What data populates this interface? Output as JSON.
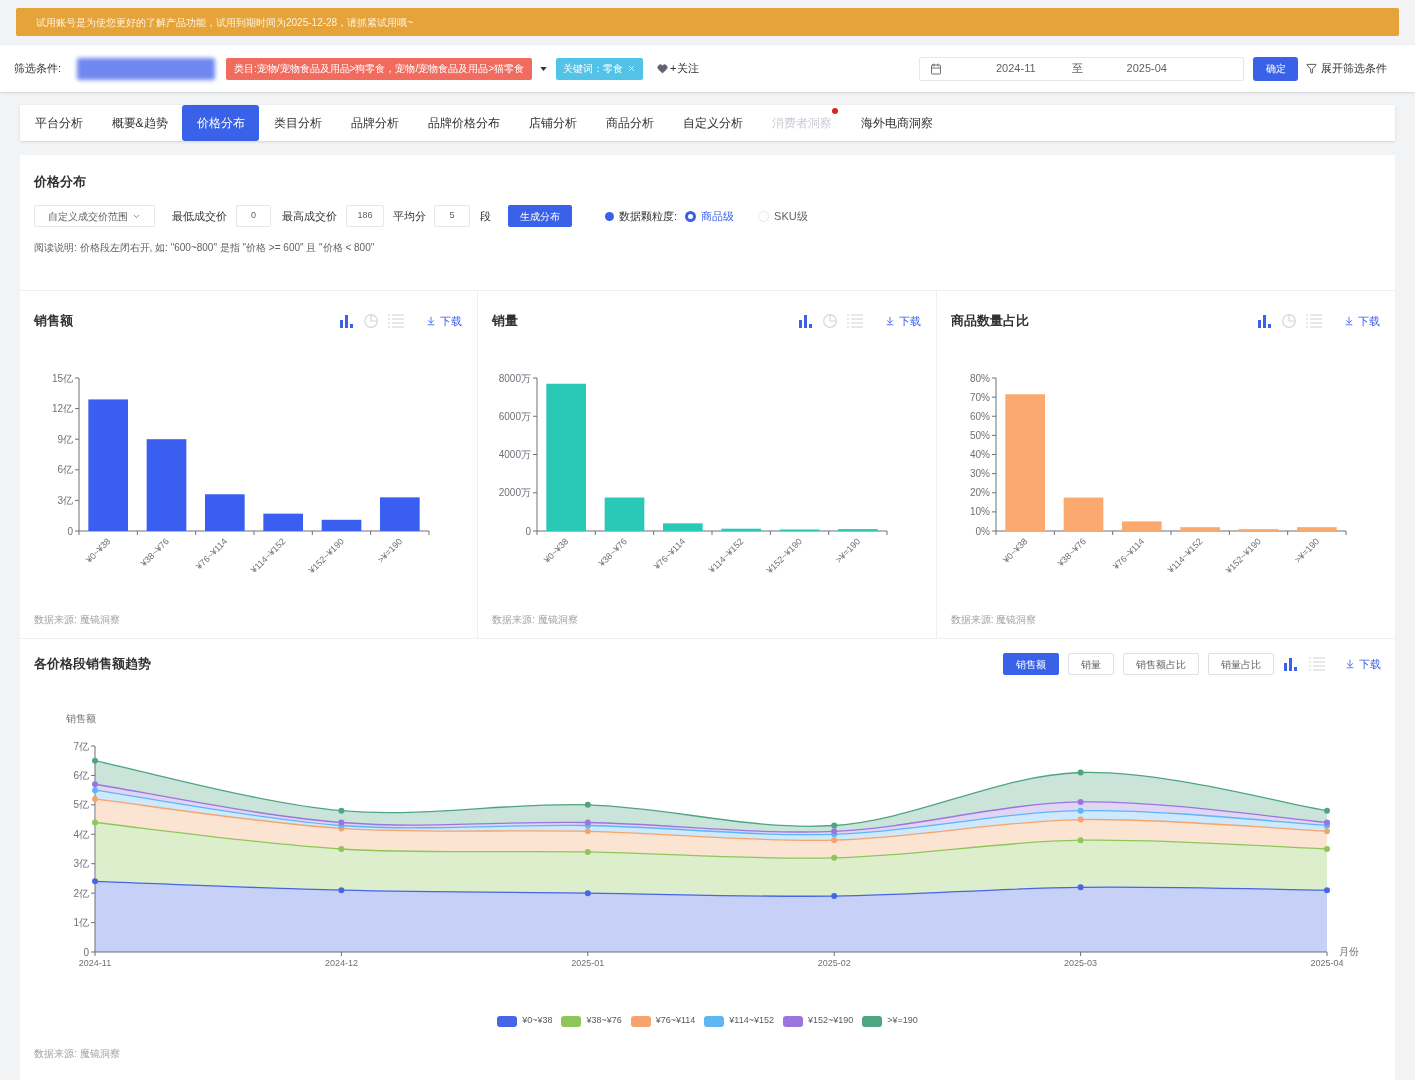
{
  "banner": {
    "text": "试用账号是为使您更好的了解产品功能，试用到期时间为2025-12-28，请抓紧试用哦~"
  },
  "filter_bar": {
    "label": "筛选条件:",
    "category_tag": "类目:宠物/宠物食品及用品>狗零食，宠物/宠物食品及用品>猫零食",
    "keyword_tag": "关键词：零食",
    "follow": "+关注",
    "date_from": "2024-11",
    "date_separator": "至",
    "date_to": "2025-04",
    "confirm_button": "确定",
    "expand_link": "展开筛选条件"
  },
  "tabs": [
    {
      "label": "平台分析",
      "selected": false,
      "disabled": false,
      "dot": false
    },
    {
      "label": "概要&趋势",
      "selected": false,
      "disabled": false,
      "dot": false
    },
    {
      "label": "价格分布",
      "selected": true,
      "disabled": false,
      "dot": false
    },
    {
      "label": "类目分析",
      "selected": false,
      "disabled": false,
      "dot": false
    },
    {
      "label": "品牌分析",
      "selected": false,
      "disabled": false,
      "dot": false
    },
    {
      "label": "品牌价格分布",
      "selected": false,
      "disabled": false,
      "dot": false
    },
    {
      "label": "店铺分析",
      "selected": false,
      "disabled": false,
      "dot": false
    },
    {
      "label": "商品分析",
      "selected": false,
      "disabled": false,
      "dot": false
    },
    {
      "label": "自定义分析",
      "selected": false,
      "disabled": false,
      "dot": false
    },
    {
      "label": "消费者洞察",
      "selected": false,
      "disabled": true,
      "dot": true
    },
    {
      "label": "海外电商洞察",
      "selected": false,
      "disabled": false,
      "dot": false
    }
  ],
  "price_distribution": {
    "title": "价格分布",
    "range_select": "自定义成交价范围",
    "min_label": "最低成交价",
    "min_value": "0",
    "max_label": "最高成交价",
    "max_value": "186",
    "split_label": "平均分",
    "split_value": "5",
    "split_unit": "段",
    "generate_button": "生成分布",
    "granularity_label": "数据颗粒度:",
    "granularity_options": [
      {
        "label": "商品级",
        "selected": true
      },
      {
        "label": "SKU级",
        "selected": false
      }
    ],
    "note": "阅读说明: 价格段左闭右开, 如: \"600~800\" 是指 \"价格 >= 600\" 且 \"价格 < 800\""
  },
  "charts": [
    {
      "title": "销售额",
      "view_toggles": [
        {
          "kind": "bar",
          "selected": true
        },
        {
          "kind": "pie",
          "selected": false
        },
        {
          "kind": "table",
          "selected": false
        }
      ],
      "download": "下载",
      "chart_data": {
        "type": "bar",
        "categories": [
          "¥0~¥38",
          "¥38~¥76",
          "¥76~¥114",
          "¥114~¥152",
          "¥152~¥190",
          ">¥=190"
        ],
        "values": [
          12.9,
          9,
          3.6,
          1.7,
          1.1,
          3.3
        ],
        "color": "#3a5ff0",
        "ylim": [
          0,
          15
        ],
        "yticks": [
          {
            "value": 0,
            "label": "0"
          },
          {
            "value": 3,
            "label": "3亿"
          },
          {
            "value": 6,
            "label": "6亿"
          },
          {
            "value": 9,
            "label": "9亿"
          },
          {
            "value": 12,
            "label": "12亿"
          },
          {
            "value": 15,
            "label": "15亿"
          }
        ]
      },
      "source": "数据来源: 魔镜洞察"
    },
    {
      "title": "销量",
      "view_toggles": [
        {
          "kind": "bar",
          "selected": true
        },
        {
          "kind": "pie",
          "selected": false
        },
        {
          "kind": "table",
          "selected": false
        }
      ],
      "download": "下载",
      "chart_data": {
        "type": "bar",
        "categories": [
          "¥0~¥38",
          "¥38~¥76",
          "¥76~¥114",
          "¥114~¥152",
          "¥152~¥190",
          ">¥=190"
        ],
        "values": [
          7700,
          1750,
          400,
          120,
          80,
          100
        ],
        "color": "#2ac8b6",
        "ylim": [
          0,
          8000
        ],
        "yticks": [
          {
            "value": 0,
            "label": "0"
          },
          {
            "value": 2000,
            "label": "2000万"
          },
          {
            "value": 4000,
            "label": "4000万"
          },
          {
            "value": 6000,
            "label": "6000万"
          },
          {
            "value": 8000,
            "label": "8000万"
          }
        ]
      },
      "source": "数据来源: 魔镜洞察"
    },
    {
      "title": "商品数量占比",
      "view_toggles": [
        {
          "kind": "bar",
          "selected": true
        },
        {
          "kind": "pie",
          "selected": false
        },
        {
          "kind": "table",
          "selected": false
        }
      ],
      "download": "下载",
      "chart_data": {
        "type": "bar",
        "categories": [
          "¥0~¥38",
          "¥38~¥76",
          "¥76~¥114",
          "¥114~¥152",
          "¥152~¥190",
          ">¥=190"
        ],
        "values": [
          71.5,
          17.5,
          5,
          2,
          1,
          2
        ],
        "color": "#fba96f",
        "ylim": [
          0,
          80
        ],
        "yticks": [
          {
            "value": 0,
            "label": "0%"
          },
          {
            "value": 10,
            "label": "10%"
          },
          {
            "value": 20,
            "label": "20%"
          },
          {
            "value": 30,
            "label": "30%"
          },
          {
            "value": 40,
            "label": "40%"
          },
          {
            "value": 50,
            "label": "50%"
          },
          {
            "value": 60,
            "label": "60%"
          },
          {
            "value": 70,
            "label": "70%"
          },
          {
            "value": 80,
            "label": "80%"
          }
        ]
      },
      "source": "数据来源: 魔镜洞察"
    }
  ],
  "trend": {
    "title": "各价格段销售额趋势",
    "metric_buttons": [
      {
        "label": "销售额",
        "selected": true
      },
      {
        "label": "销量",
        "selected": false
      },
      {
        "label": "销售额占比",
        "selected": false
      },
      {
        "label": "销量占比",
        "selected": false
      }
    ],
    "view_toggles": [
      {
        "kind": "bar",
        "selected": true
      },
      {
        "kind": "table",
        "selected": false
      }
    ],
    "download": "下载",
    "chart_data": {
      "type": "area",
      "stacked": true,
      "ylabel": "销售额",
      "xlabel": "月份",
      "categories": [
        "2024-11",
        "2024-12",
        "2025-01",
        "2025-02",
        "2025-03",
        "2025-04"
      ],
      "ylim": [
        0,
        7
      ],
      "yticks": [
        {
          "value": 0,
          "label": "0"
        },
        {
          "value": 1,
          "label": "1亿"
        },
        {
          "value": 2,
          "label": "2亿"
        },
        {
          "value": 3,
          "label": "3亿"
        },
        {
          "value": 4,
          "label": "4亿"
        },
        {
          "value": 5,
          "label": "5亿"
        },
        {
          "value": 6,
          "label": "6亿"
        },
        {
          "value": 7,
          "label": "7亿"
        }
      ],
      "legend": "bottom",
      "marker": "circle",
      "series": [
        {
          "name": "¥0~¥38",
          "color": "#4766e6",
          "values": [
            2.4,
            2.1,
            2.0,
            1.9,
            2.2,
            2.1
          ]
        },
        {
          "name": "¥38~¥76",
          "color": "#8fc65a",
          "values": [
            2.0,
            1.4,
            1.4,
            1.3,
            1.6,
            1.4
          ]
        },
        {
          "name": "¥76~¥114",
          "color": "#f6a46c",
          "values": [
            0.8,
            0.7,
            0.7,
            0.6,
            0.7,
            0.6
          ]
        },
        {
          "name": "¥114~¥152",
          "color": "#5eb6f2",
          "values": [
            0.3,
            0.1,
            0.2,
            0.2,
            0.3,
            0.2
          ]
        },
        {
          "name": "¥152~¥190",
          "color": "#9b75dd",
          "values": [
            0.2,
            0.1,
            0.1,
            0.1,
            0.3,
            0.1
          ]
        },
        {
          "name": ">¥=190",
          "color": "#4ea584",
          "values": [
            0.8,
            0.4,
            0.6,
            0.2,
            1.0,
            0.4
          ]
        }
      ]
    },
    "source": "数据来源: 魔镜洞察"
  }
}
